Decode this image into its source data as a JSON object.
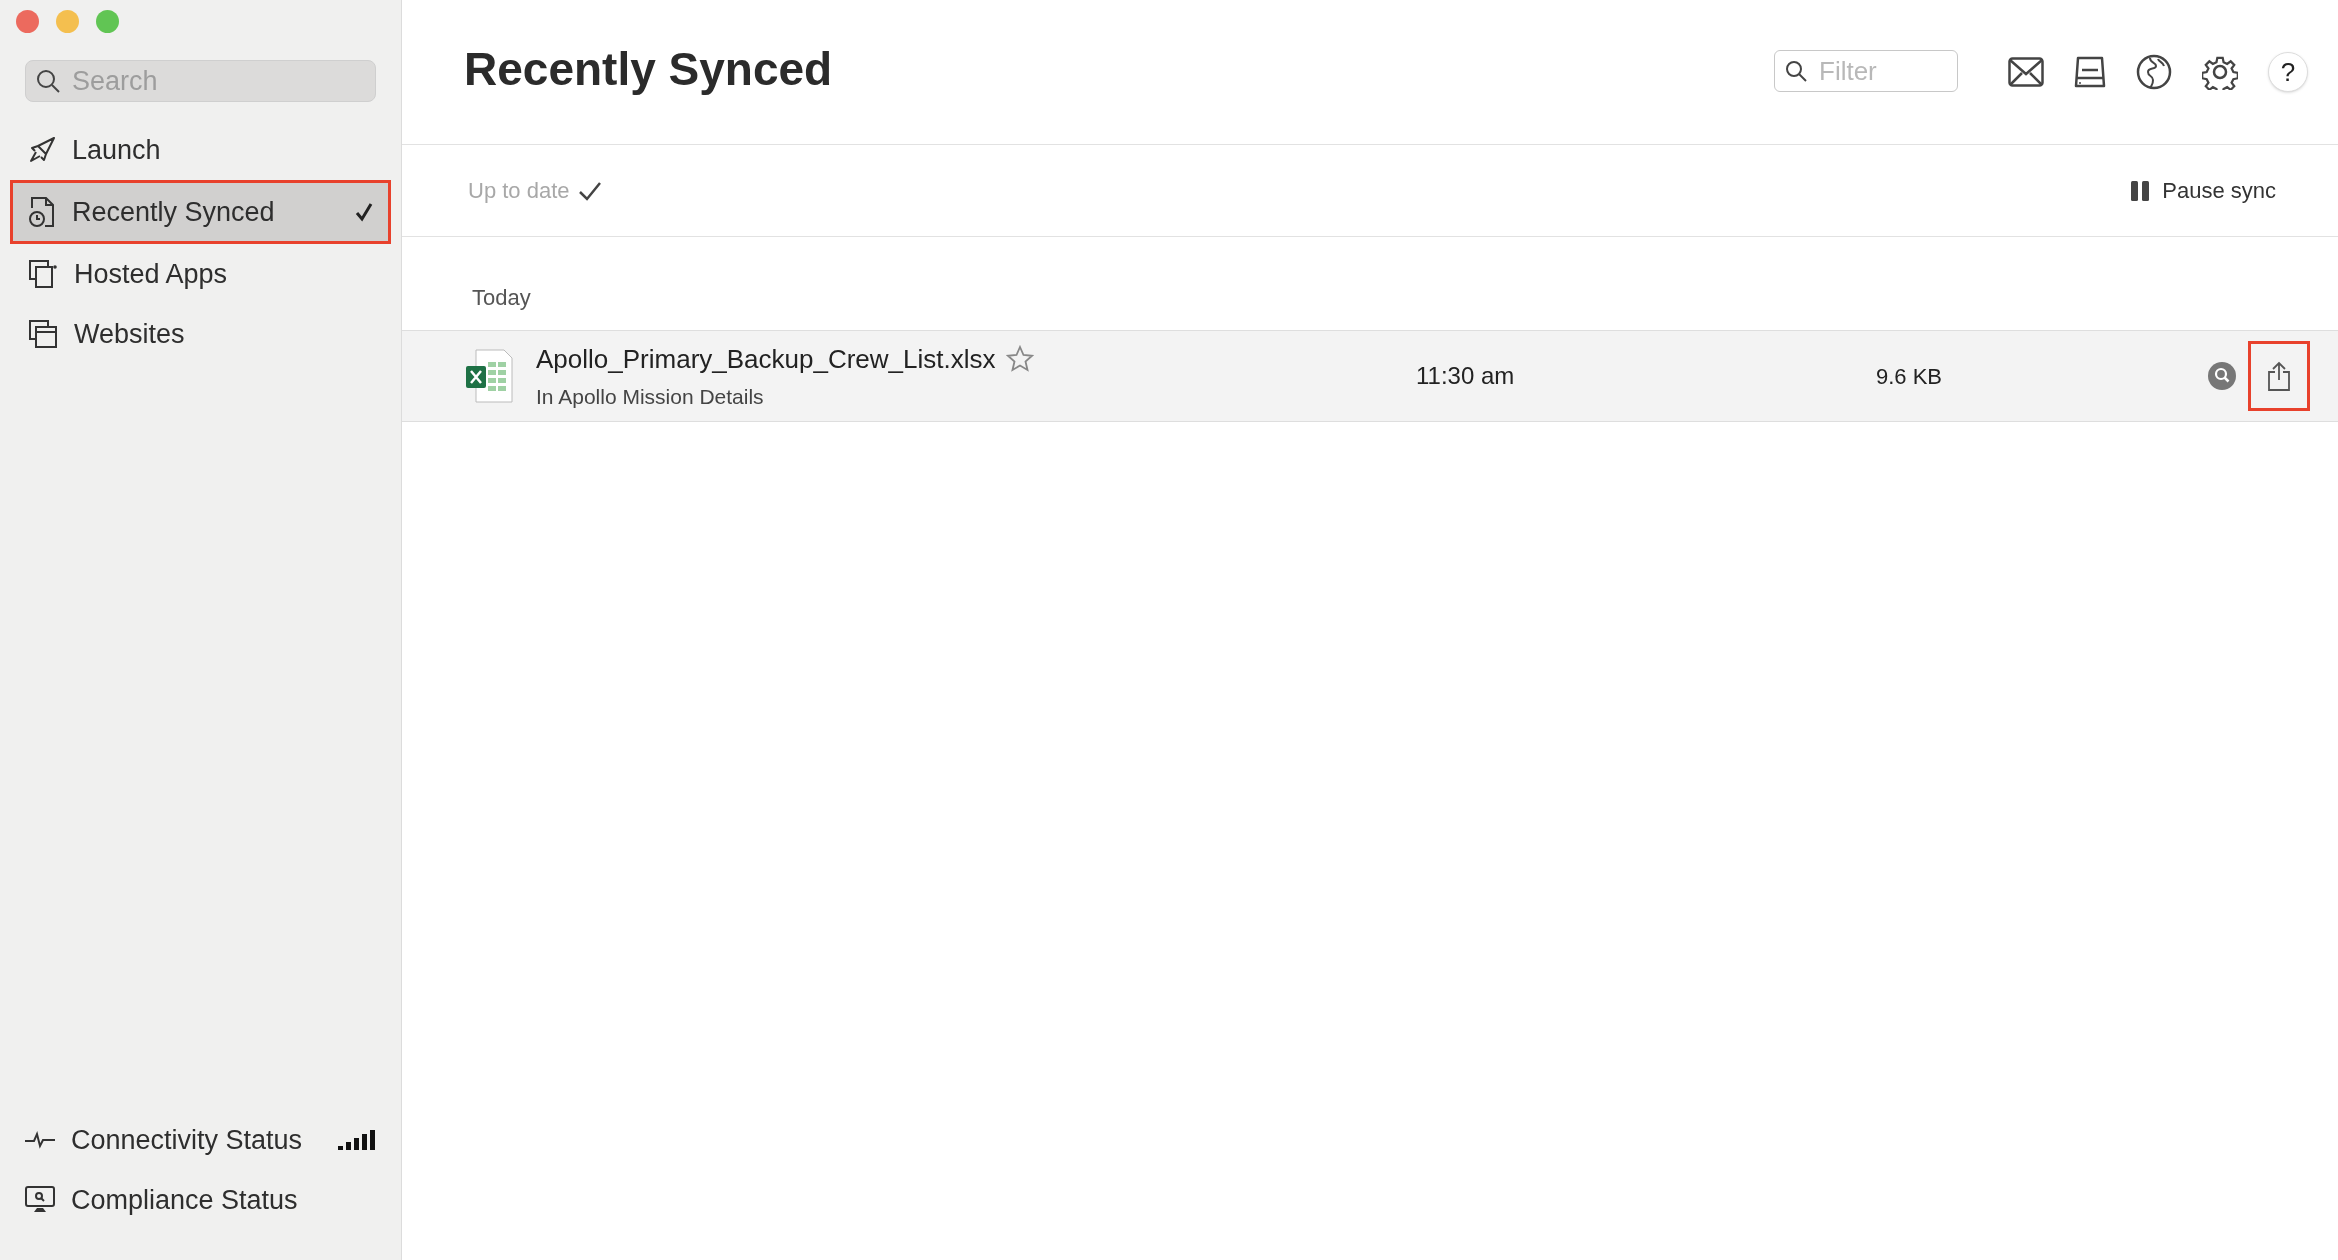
{
  "window": {
    "title": "Recently Synced"
  },
  "sidebar": {
    "search": {
      "placeholder": "Search"
    },
    "items": [
      {
        "label": "Launch",
        "selected": false
      },
      {
        "label": "Recently Synced",
        "selected": true
      },
      {
        "label": "Hosted Apps",
        "selected": false
      },
      {
        "label": "Websites",
        "selected": false
      }
    ],
    "footer_items": [
      {
        "label": "Connectivity Status",
        "kind": "signal"
      },
      {
        "label": "Compliance Status",
        "kind": "plain"
      }
    ]
  },
  "toolbar": {
    "filter": {
      "placeholder": "Filter"
    },
    "help_button": "?"
  },
  "status": {
    "text": "Up to date",
    "pause_button": "Pause sync"
  },
  "groups": [
    {
      "heading": "Today",
      "files": [
        {
          "name": "Apollo_Primary_Backup_Crew_List.xlsx",
          "location": "In Apollo Mission Details",
          "time": "11:30 am",
          "size": "9.6 KB",
          "starred": false,
          "share_highlighted": true
        }
      ]
    }
  ]
}
